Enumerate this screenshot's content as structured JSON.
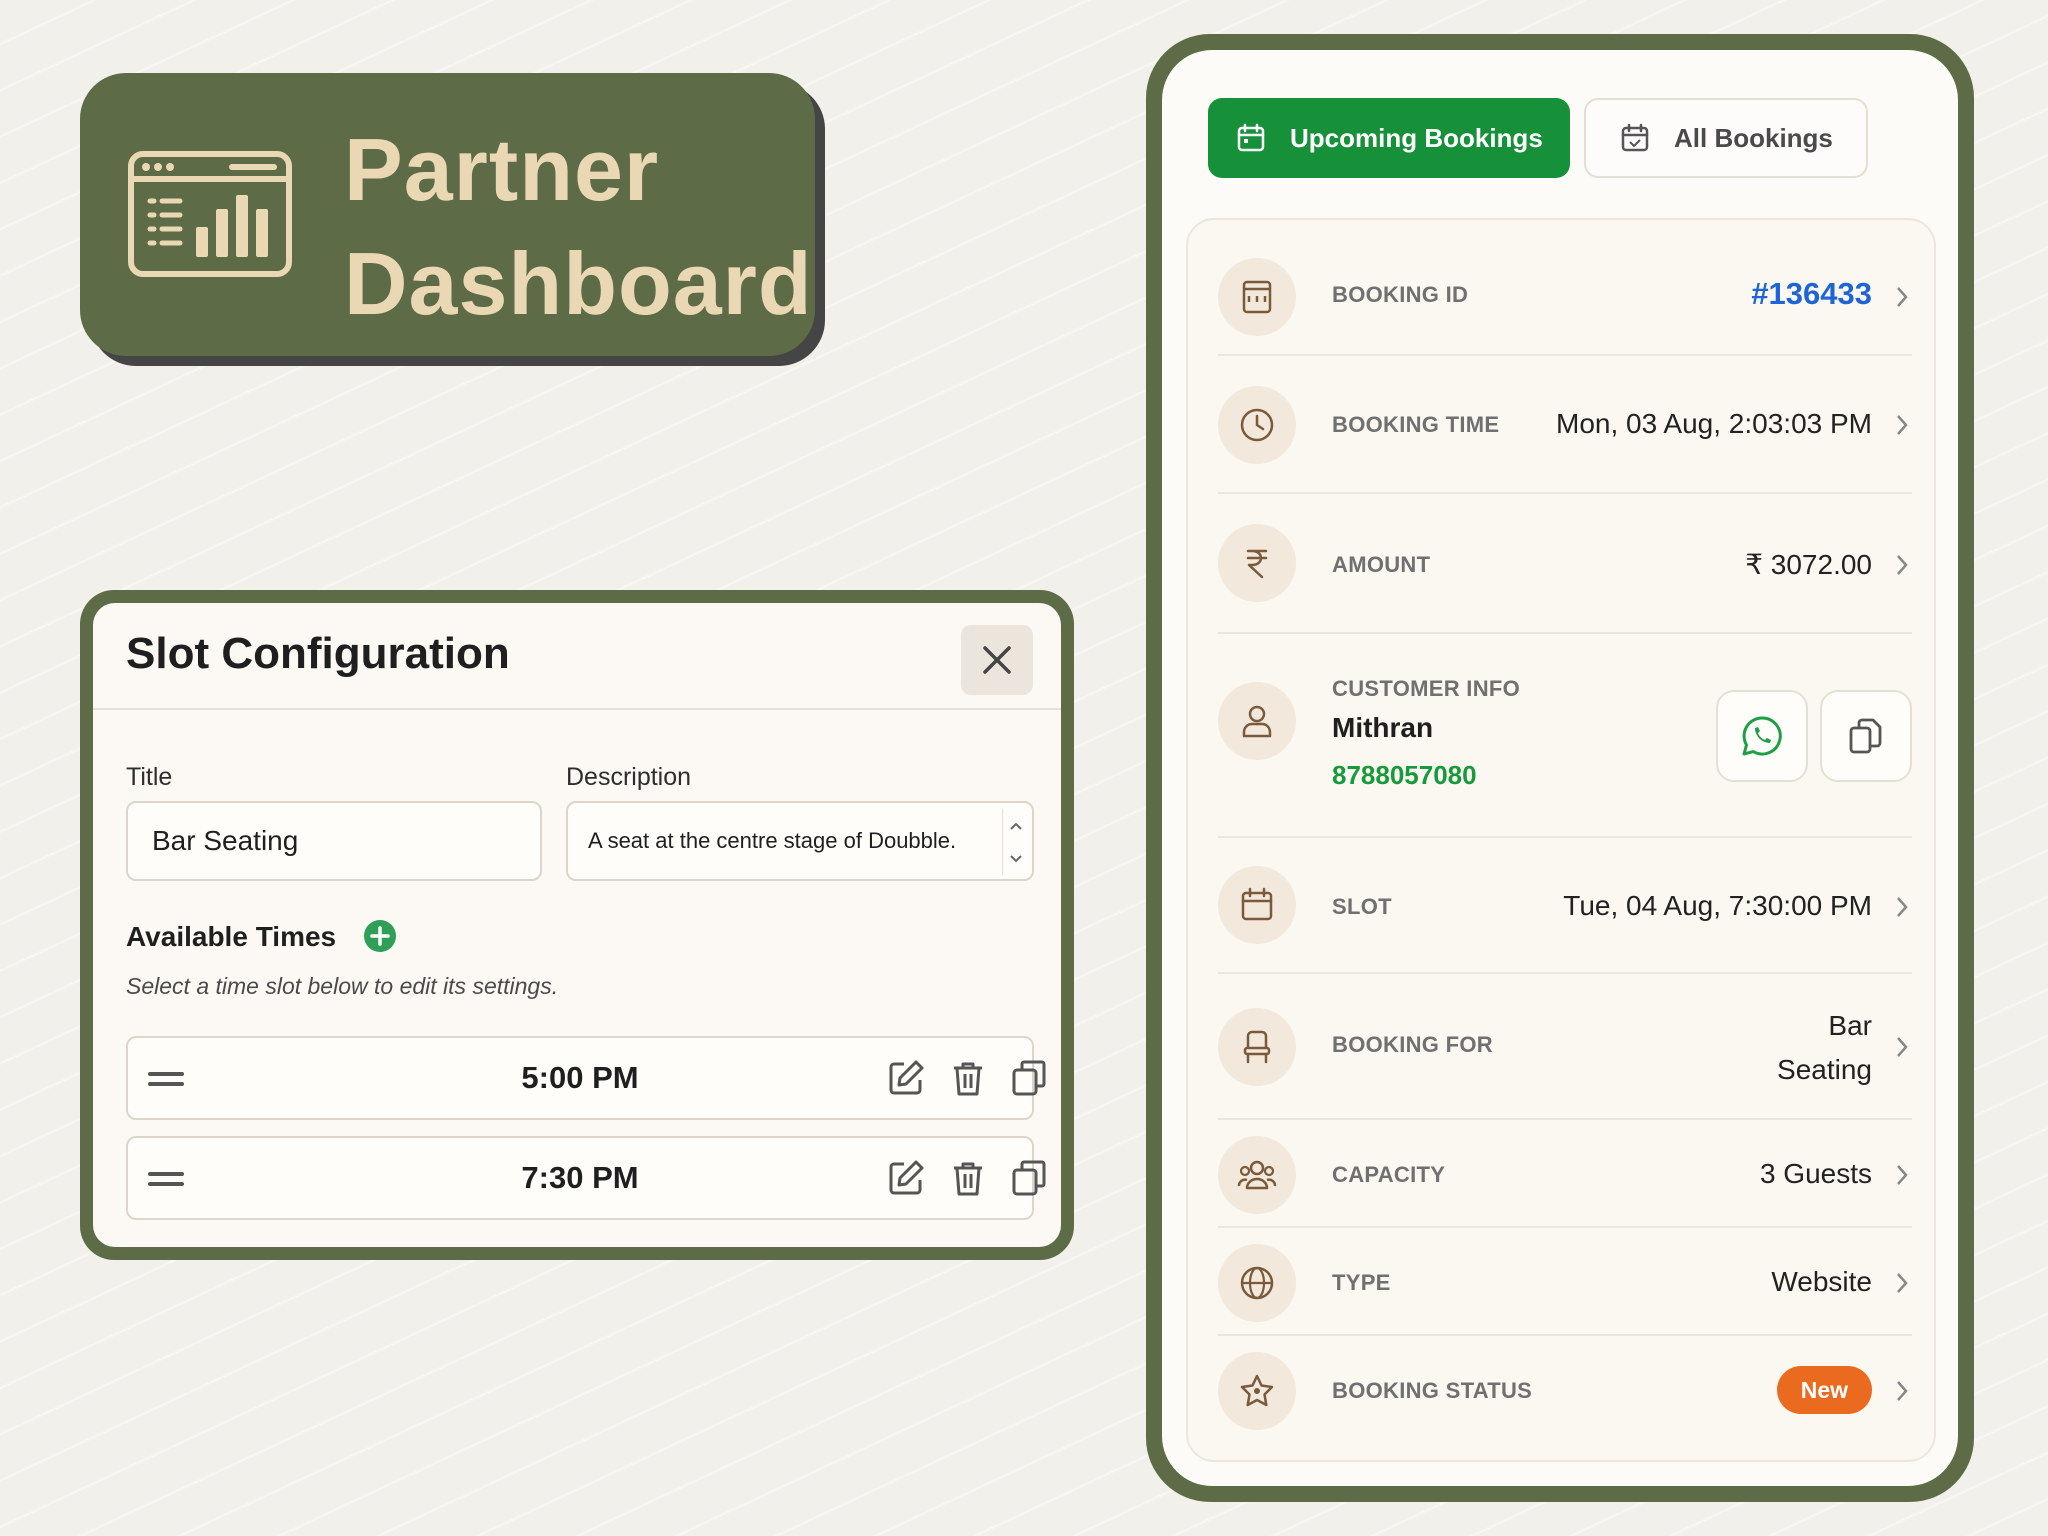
{
  "header": {
    "title_line1": "Partner",
    "title_line2": "Dashboard",
    "icon": "dashboard-chart-icon"
  },
  "slot_config": {
    "title": "Slot Configuration",
    "close_icon": "close-icon",
    "title_label": "Title",
    "title_value": "Bar Seating",
    "description_label": "Description",
    "description_value": "A seat at the centre stage of Doubble.",
    "available_times_label": "Available Times",
    "hint": "Select a time slot below to edit its settings.",
    "times": [
      {
        "time": "5:00 PM"
      },
      {
        "time": "7:30 PM"
      }
    ]
  },
  "booking": {
    "tabs": {
      "upcoming": "Upcoming Bookings",
      "all": "All Bookings"
    },
    "booking_id_label": "BOOKING ID",
    "booking_id_value": "#136433",
    "booking_time_label": "BOOKING TIME",
    "booking_time_value": "Mon, 03 Aug, 2:03:03 PM",
    "amount_label": "AMOUNT",
    "amount_value": "₹ 3072.00",
    "customer_label": "CUSTOMER INFO",
    "customer_name": "Mithran",
    "customer_phone": "8788057080",
    "slot_label": "SLOT",
    "slot_value": "Tue, 04 Aug, 7:30:00 PM",
    "booking_for_label": "BOOKING FOR",
    "booking_for_line1": "Bar",
    "booking_for_line2": "Seating",
    "capacity_label": "CAPACITY",
    "capacity_value": "3 Guests",
    "type_label": "TYPE",
    "type_value": "Website",
    "status_label": "BOOKING STATUS",
    "status_value": "New"
  },
  "colors": {
    "frame_green": "#5d6c46",
    "accent_green": "#16913a",
    "title_beige": "#ead8b4",
    "link_blue": "#1f64d6",
    "status_orange": "#ea6a1f"
  }
}
